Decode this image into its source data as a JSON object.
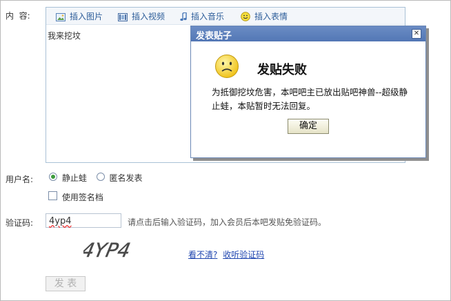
{
  "labels": {
    "content": "内  容:",
    "username": "用户名:",
    "vcode": "验证码:"
  },
  "toolbar": {
    "items": [
      {
        "label": "插入图片",
        "icon": "image-icon"
      },
      {
        "label": "插入视频",
        "icon": "video-icon"
      },
      {
        "label": "插入音乐",
        "icon": "music-note-icon"
      },
      {
        "label": "插入表情",
        "icon": "smiley-icon"
      }
    ]
  },
  "editor": {
    "content": "我来挖坟"
  },
  "dialog": {
    "title": "发表贴子",
    "close": "✕",
    "heading": "发贴失败",
    "icon": "sad-face-icon",
    "message": "为抵御挖坟危害，本吧吧主已放出贴吧神兽--超级静止蛙，本贴暂时无法回复。",
    "ok_label": "确定"
  },
  "user": {
    "name_option": "静止蛙",
    "anonymous_option": "匿名发表",
    "signature_label": "使用签名档"
  },
  "vcode": {
    "value": "4yp4",
    "hint": "请点击后输入验证码，加入会员后本吧发贴免验证码。",
    "captcha_text": "4YP4",
    "cant_see_link": "看不清?",
    "listen_link": "收听验证码"
  },
  "submit_label": "发 表",
  "colors": {
    "dialog_title_bg": "#5a7fbd",
    "link": "#2046b0",
    "radio_selected": "#3d9b3d"
  }
}
